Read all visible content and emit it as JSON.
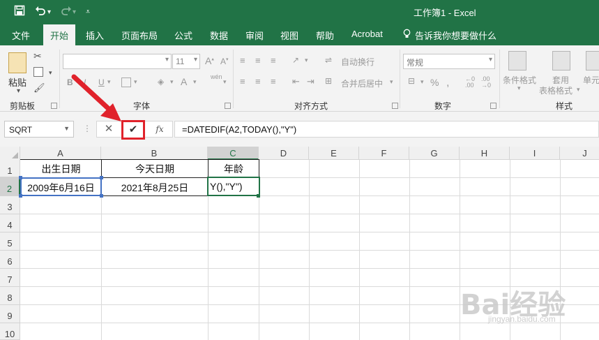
{
  "window": {
    "title": "工作簿1  -  Excel"
  },
  "quick_access": {
    "save_icon": "save-icon",
    "undo_icon": "undo-icon",
    "redo_icon": "redo-icon",
    "customize_icon": "customize-icon"
  },
  "tabs": [
    {
      "label": "文件"
    },
    {
      "label": "开始"
    },
    {
      "label": "插入"
    },
    {
      "label": "页面布局"
    },
    {
      "label": "公式"
    },
    {
      "label": "数据"
    },
    {
      "label": "审阅"
    },
    {
      "label": "视图"
    },
    {
      "label": "帮助"
    },
    {
      "label": "Acrobat"
    },
    {
      "label": "告诉我你想要做什么"
    }
  ],
  "ribbon": {
    "clipboard": {
      "paste_label": "粘贴",
      "group_label": "剪贴板"
    },
    "font": {
      "font_size": "11",
      "group_label": "字体",
      "bold": "B",
      "italic": "I",
      "underline": "U",
      "wen": "wén"
    },
    "alignment": {
      "wrap_text": "自动换行",
      "merge_center": "合并后居中",
      "group_label": "对齐方式"
    },
    "number": {
      "format": "常规",
      "group_label": "数字",
      "percent": "%"
    },
    "styles": {
      "conditional_format": "条件格式",
      "table_format_1": "套用",
      "table_format_2": "表格格式",
      "cell_styles": "单元",
      "group_label": "样式"
    }
  },
  "formula_bar": {
    "name_box": "SQRT",
    "cancel": "✕",
    "enter": "✔",
    "fx": "fx",
    "formula": "=DATEDIF(A2,TODAY(),\"Y\")"
  },
  "columns": [
    "A",
    "B",
    "C",
    "D",
    "E",
    "F",
    "G",
    "H",
    "I",
    "J"
  ],
  "rows": [
    "1",
    "2",
    "3",
    "4",
    "5",
    "6",
    "7",
    "8",
    "9",
    "10"
  ],
  "cells": {
    "A1": "出生日期",
    "B1": "今天日期",
    "C1": "年龄",
    "A2": "2009年6月16日",
    "B2": "2021年8月25日",
    "C2": "Y(),\"Y\")"
  },
  "watermark": {
    "main": "Bai经验",
    "sub": "jingyan.baidu.com"
  },
  "colors": {
    "excel_green": "#217346",
    "highlight_red": "#e0222b",
    "selection_blue": "#4472c4"
  }
}
